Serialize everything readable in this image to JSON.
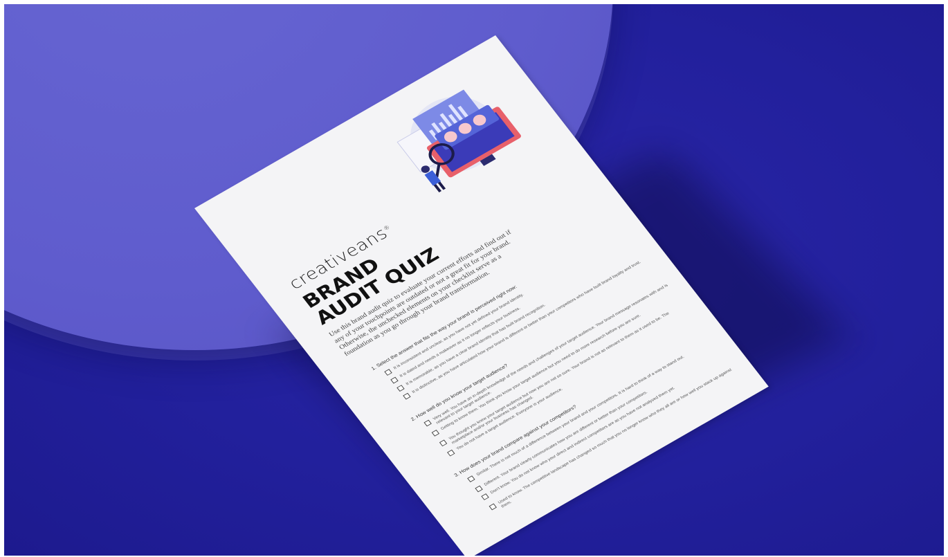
{
  "brand": {
    "logo": "creativeans",
    "logo_mark": "®"
  },
  "document": {
    "title_line1": "BRAND",
    "title_line2": "AUDIT QUIZ",
    "intro": "Use this brand audit quiz to evaluate your current efforts and find out if any of your touchpoints are outdated or not a great fit for your brand. Otherwise, the unchecked elements on your checklist serve as a foundation as you go through your brand transformation.",
    "questions": [
      {
        "text": "1. Select the answer that fits the way your brand is perceived right now:",
        "options": [
          "It is inconsistent and unclear, as you have not yet defined your brand identity.",
          "It is dated and needs a makeover as it no longer reflects your business.",
          "It is memorable, as you have a clear brand identity that has built brand recognition.",
          "It is distinctive, as you have articulated how your brand is different or better than your competitors who have built brand loyalty and trust."
        ]
      },
      {
        "text": "2. How well do you know your target audience?",
        "options": [
          "Very well. You have an in-depth knowledge of the needs and challenges of your target audience. Your brand message resonates with and is relevant to your target audience.",
          "Getting to know them. You think you know your target audience but you need to do more research before you are sure.",
          "You thought you knew your target audience but now you are not so sure. Your brand is not as relevant to them as it used to be. The marketplace and/or your business has changed.",
          "You do not have a target audience. Everyone is your audience."
        ]
      },
      {
        "text": "3. How does your brand compare against your competitors?",
        "options": [
          "Similar. There is not much of a difference between your brand and your competitors. It is hard to think of a way to stand out.",
          "Different. Your brand clearly communicates how you are different or better than your competitors.",
          "Don't know. You do not know who your direct and indirect competitors are as you have not analysed them yet.",
          "Used to know. The competitive landscape has changed so much that you no longer know who they all are or how well you stack up against them."
        ]
      }
    ]
  },
  "colors": {
    "background": "#22209c",
    "disc": "#5f5ccd",
    "paper": "#f4f4f6",
    "illustration_accent": "#e8606a",
    "illustration_primary": "#3b3bb8"
  }
}
